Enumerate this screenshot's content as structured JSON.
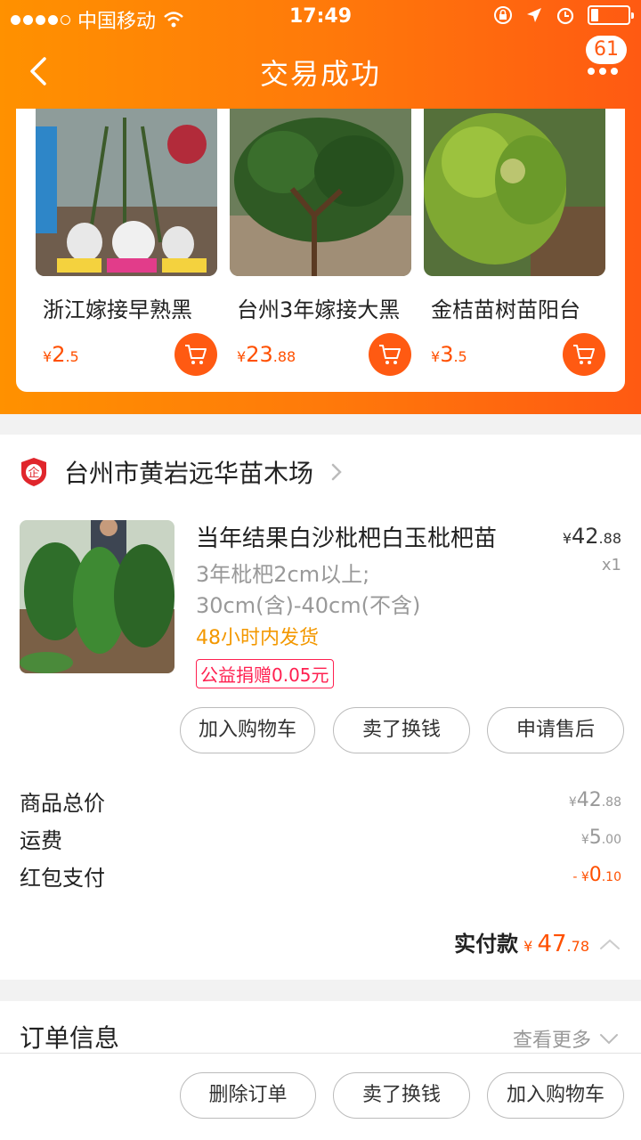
{
  "status_bar": {
    "carrier": "中国移动",
    "time": "17:49"
  },
  "nav": {
    "title": "交易成功",
    "badge_count": "61",
    "back_icon": "chevron-left-icon",
    "more_icon": "more-dots-icon"
  },
  "recommend": {
    "items": [
      {
        "title": "浙江嫁接早熟黑",
        "price_symbol": "¥",
        "price_int": "2",
        "price_dec": ".5"
      },
      {
        "title": "台州3年嫁接大黑",
        "price_symbol": "¥",
        "price_int": "23",
        "price_dec": ".88"
      },
      {
        "title": "金桔苗树苗阳台",
        "price_symbol": "¥",
        "price_int": "3",
        "price_dec": ".5"
      }
    ]
  },
  "shop": {
    "icon_text": "企",
    "name": "台州市黄岩远华苗木场"
  },
  "product": {
    "title": "当年结果白沙枇杷白玉枇杷苗",
    "spec_line1": "3年枇杷2cm以上;",
    "spec_line2": "30cm(含)-40cm(不含)",
    "shipping": "48小时内发货",
    "charity_tag": "公益捐赠0.05元",
    "price_symbol": "¥",
    "price_int": "42",
    "price_dec": ".88",
    "quantity": "x1"
  },
  "product_actions": {
    "add_cart": "加入购物车",
    "sell": "卖了换钱",
    "after_sale": "申请售后"
  },
  "fees": {
    "subtotal_label": "商品总价",
    "subtotal_symbol": "¥",
    "subtotal_int": "42",
    "subtotal_dec": ".88",
    "shipping_label": "运费",
    "shipping_symbol": "¥",
    "shipping_int": "5",
    "shipping_dec": ".00",
    "redpacket_label": "红包支付",
    "redpacket_prefix": "- ¥",
    "redpacket_int": "0",
    "redpacket_dec": ".10"
  },
  "total": {
    "label": "实付款",
    "symbol": "¥",
    "int": "47",
    "dec": ".78"
  },
  "order_info": {
    "title": "订单信息",
    "see_more": "查看更多"
  },
  "bottom_actions": {
    "delete": "删除订单",
    "sell": "卖了换钱",
    "add_cart": "加入购物车"
  },
  "colors": {
    "brand_orange": "#ff5000",
    "ship_orange": "#f39800",
    "charity_red": "#ff2050"
  }
}
